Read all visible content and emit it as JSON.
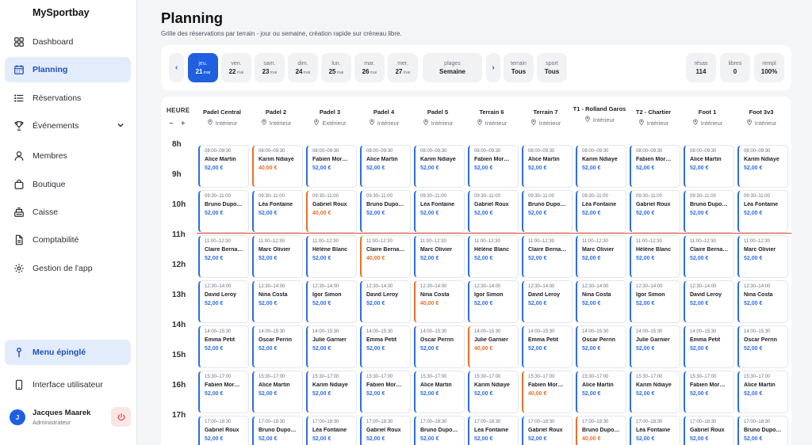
{
  "brand": "MySportbay",
  "nav": [
    {
      "label": "Dashboard",
      "icon": "grid-icon"
    },
    {
      "label": "Planning",
      "icon": "calendar-icon",
      "active": true
    },
    {
      "label": "Réservations",
      "icon": "list-icon"
    },
    {
      "label": "Événements",
      "icon": "trophy-icon",
      "expandable": true
    },
    {
      "label": "Membres",
      "icon": "user-icon"
    },
    {
      "label": "Boutique",
      "icon": "bag-icon"
    },
    {
      "label": "Caisse",
      "icon": "register-icon"
    },
    {
      "label": "Comptabilité",
      "icon": "document-icon"
    },
    {
      "label": "Gestion de l'app",
      "icon": "gear-icon"
    }
  ],
  "pinned": {
    "label": "Menu épinglé",
    "icon": "pin-icon"
  },
  "ui_link": {
    "label": "Interface utilisateur",
    "icon": "phone-icon"
  },
  "user": {
    "initial": "J",
    "name": "Jacques Maarek",
    "role": "Administrateur"
  },
  "header": {
    "title": "Planning",
    "subtitle": "Grille des réservations par terrain - jour ou semaine, création rapide sur créneau libre."
  },
  "toolbar": {
    "prev": "‹",
    "next": "›",
    "days": [
      {
        "day": "jeu.",
        "num": "21",
        "month": "mai",
        "active": true
      },
      {
        "day": "ven.",
        "num": "22",
        "month": "mai"
      },
      {
        "day": "sam.",
        "num": "23",
        "month": "mai"
      },
      {
        "day": "dim.",
        "num": "24",
        "month": "mai"
      },
      {
        "day": "lun.",
        "num": "25",
        "month": "mai"
      },
      {
        "day": "mar.",
        "num": "26",
        "month": "mai"
      },
      {
        "day": "mer.",
        "num": "27",
        "month": "mai"
      }
    ],
    "week": {
      "label": "plages",
      "value": "Semaine"
    },
    "filters": [
      {
        "label": "terrain",
        "value": "Tous"
      },
      {
        "label": "sport",
        "value": "Tous"
      }
    ],
    "stats": [
      {
        "label": "résas",
        "value": "114"
      },
      {
        "label": "libres",
        "value": "0"
      },
      {
        "label": "rempl",
        "value": "100%"
      }
    ]
  },
  "grid": {
    "heure_label": "HEURE",
    "minus": "−",
    "plus": "+",
    "hours": [
      "8h",
      "9h",
      "10h",
      "11h",
      "12h",
      "13h",
      "14h",
      "15h",
      "16h",
      "17h"
    ],
    "columns": [
      {
        "name": "Padel Central",
        "place": "Intérieur"
      },
      {
        "name": "Padel 2",
        "place": "Intérieur"
      },
      {
        "name": "Padel 3",
        "place": "Extérieur"
      },
      {
        "name": "Padel 4",
        "place": "Intérieur"
      },
      {
        "name": "Padel 5",
        "place": "Intérieur"
      },
      {
        "name": "Terrain 6",
        "place": "Intérieur"
      },
      {
        "name": "Terrain 7",
        "place": "Intérieur"
      },
      {
        "name": "T1 - Rolland Garos",
        "place": "Intérieur"
      },
      {
        "name": "T2 - Chartier",
        "place": "Intérieur"
      },
      {
        "name": "Foot 1",
        "place": "Intérieur"
      },
      {
        "name": "Foot 3v3",
        "place": "Intérieur"
      }
    ],
    "times": [
      "08:00–09:30",
      "09:30–11:00",
      "11:00–12:30",
      "12:30–14:00",
      "14:00–15:30",
      "15:30–17:00",
      "17:00–18:30"
    ],
    "rows": [
      [
        [
          "Alice Martin",
          "52,00 €"
        ],
        [
          "Karim Ndiaye",
          "40,00 €",
          true
        ],
        [
          "Fabien Mor…",
          "52,00 €"
        ],
        [
          "Alice Martin",
          "52,00 €"
        ],
        [
          "Karim Ndiaye",
          "52,00 €"
        ],
        [
          "Fabien Mor…",
          "52,00 €"
        ],
        [
          "Alice Martin",
          "52,00 €"
        ],
        [
          "Karim Ndiaye",
          "52,00 €"
        ],
        [
          "Fabien Mor…",
          "52,00 €"
        ],
        [
          "Alice Martin",
          "52,00 €"
        ],
        [
          "Karim Ndiaye",
          "52,00 €"
        ]
      ],
      [
        [
          "Bruno Dupo…",
          "52,00 €"
        ],
        [
          "Léa Fontaine",
          "52,00 €"
        ],
        [
          "Gabriel Roux",
          "40,00 €",
          true
        ],
        [
          "Bruno Dupo…",
          "52,00 €"
        ],
        [
          "Léa Fontaine",
          "52,00 €"
        ],
        [
          "Gabriel Roux",
          "52,00 €"
        ],
        [
          "Bruno Dupo…",
          "52,00 €"
        ],
        [
          "Léa Fontaine",
          "52,00 €"
        ],
        [
          "Gabriel Roux",
          "52,00 €"
        ],
        [
          "Bruno Dupo…",
          "52,00 €"
        ],
        [
          "Léa Fontaine",
          "52,00 €"
        ]
      ],
      [
        [
          "Claire Berna…",
          "52,00 €"
        ],
        [
          "Marc Olivier",
          "52,00 €"
        ],
        [
          "Hélène Blanc",
          "52,00 €"
        ],
        [
          "Claire Berna…",
          "40,00 €",
          true
        ],
        [
          "Marc Olivier",
          "52,00 €"
        ],
        [
          "Hélène Blanc",
          "52,00 €"
        ],
        [
          "Claire Berna…",
          "52,00 €"
        ],
        [
          "Marc Olivier",
          "52,00 €"
        ],
        [
          "Hélène Blanc",
          "52,00 €"
        ],
        [
          "Claire Berna…",
          "52,00 €"
        ],
        [
          "Marc Olivier",
          "52,00 €"
        ]
      ],
      [
        [
          "David Leroy",
          "52,00 €"
        ],
        [
          "Nina Costa",
          "52,00 €"
        ],
        [
          "Igor Simon",
          "52,00 €"
        ],
        [
          "David Leroy",
          "52,00 €"
        ],
        [
          "Nina Costa",
          "40,00 €",
          true
        ],
        [
          "Igor Simon",
          "52,00 €"
        ],
        [
          "David Leroy",
          "52,00 €"
        ],
        [
          "Nina Costa",
          "52,00 €"
        ],
        [
          "Igor Simon",
          "52,00 €"
        ],
        [
          "David Leroy",
          "52,00 €"
        ],
        [
          "Nina Costa",
          "52,00 €"
        ]
      ],
      [
        [
          "Emma Petit",
          "52,00 €"
        ],
        [
          "Oscar Perrin",
          "52,00 €"
        ],
        [
          "Julie Garnier",
          "52,00 €"
        ],
        [
          "Emma Petit",
          "52,00 €"
        ],
        [
          "Oscar Perrin",
          "52,00 €"
        ],
        [
          "Julie Garnier",
          "40,00 €",
          true
        ],
        [
          "Emma Petit",
          "52,00 €"
        ],
        [
          "Oscar Perrin",
          "52,00 €"
        ],
        [
          "Julie Garnier",
          "52,00 €"
        ],
        [
          "Emma Petit",
          "52,00 €"
        ],
        [
          "Oscar Perrin",
          "52,00 €"
        ]
      ],
      [
        [
          "Fabien Mor…",
          "52,00 €"
        ],
        [
          "Alice Martin",
          "52,00 €"
        ],
        [
          "Karim Ndiaye",
          "52,00 €"
        ],
        [
          "Fabien Mor…",
          "52,00 €"
        ],
        [
          "Alice Martin",
          "52,00 €"
        ],
        [
          "Karim Ndiaye",
          "52,00 €"
        ],
        [
          "Fabien Mor…",
          "40,00 €",
          true
        ],
        [
          "Alice Martin",
          "52,00 €"
        ],
        [
          "Karim Ndiaye",
          "52,00 €"
        ],
        [
          "Fabien Mor…",
          "52,00 €"
        ],
        [
          "Alice Martin",
          "52,00 €"
        ]
      ],
      [
        [
          "Gabriel Roux",
          "52,00 €"
        ],
        [
          "Bruno Dupo…",
          "52,00 €"
        ],
        [
          "Léa Fontaine",
          "52,00 €"
        ],
        [
          "Gabriel Roux",
          "52,00 €"
        ],
        [
          "Bruno Dupo…",
          "52,00 €"
        ],
        [
          "Léa Fontaine",
          "52,00 €"
        ],
        [
          "Gabriel Roux",
          "52,00 €"
        ],
        [
          "Bruno Dupo…",
          "40,00 €",
          true
        ],
        [
          "Léa Fontaine",
          "52,00 €"
        ],
        [
          "Gabriel Roux",
          "52,00 €"
        ],
        [
          "Bruno Dupo…",
          "52,00 €"
        ]
      ]
    ]
  },
  "colors": {
    "accent": "#1f5fe0",
    "slot_standard": "#2f6ee3",
    "slot_reduced": "#e8702a",
    "now_line": "#e24a2a"
  }
}
